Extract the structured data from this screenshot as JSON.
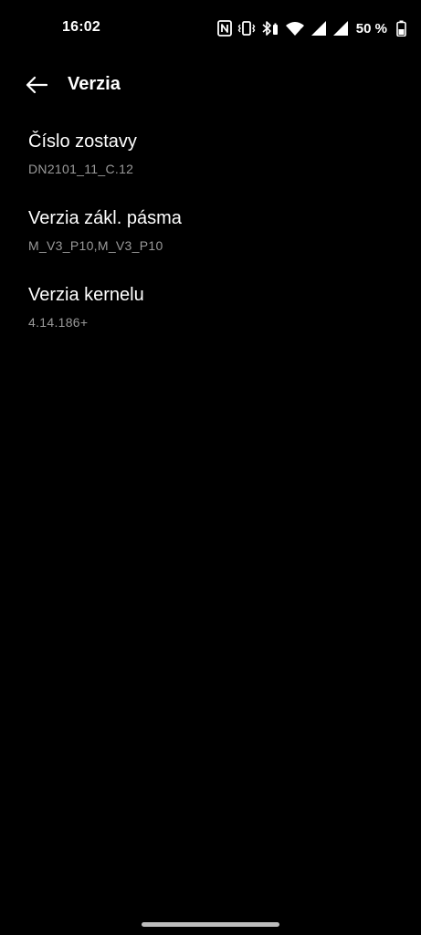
{
  "status_bar": {
    "time": "16:02",
    "battery_percent": "50 %",
    "icons": [
      "nfc-icon",
      "vibrate-icon",
      "bluetooth-battery-icon",
      "wifi-icon",
      "cellular-signal-icon",
      "cellular-signal-icon",
      "battery-icon"
    ]
  },
  "header": {
    "back_icon": "arrow-back-icon",
    "title": "Verzia"
  },
  "items": [
    {
      "title": "Číslo zostavy",
      "value": "DN2101_11_C.12"
    },
    {
      "title": "Verzia zákl. pásma",
      "value": "M_V3_P10,M_V3_P10"
    },
    {
      "title": "Verzia kernelu",
      "value": "4.14.186+"
    }
  ],
  "colors": {
    "background": "#000000",
    "primary_text": "#ffffff",
    "secondary_text": "#9a9a9a"
  }
}
